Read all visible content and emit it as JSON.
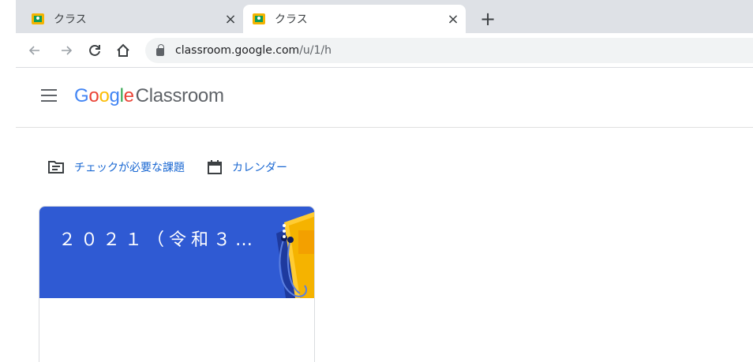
{
  "browser": {
    "tabs": [
      {
        "title": "クラス",
        "active": false
      },
      {
        "title": "クラス",
        "active": true
      }
    ],
    "close_glyph": "×",
    "new_tab_glyph": "+",
    "url_host": "classroom.google.com",
    "url_path": "/u/1/h"
  },
  "app": {
    "brand_google": [
      "G",
      "o",
      "o",
      "g",
      "l",
      "e"
    ],
    "brand_product": "Classroom"
  },
  "quick_links": {
    "todo_label": "チェックが必要な課題",
    "calendar_label": "カレンダー"
  },
  "classes": [
    {
      "title": "２０２１（令和３）…"
    }
  ],
  "colors": {
    "card_header": "#2f5ad3",
    "link": "#1967d2"
  }
}
